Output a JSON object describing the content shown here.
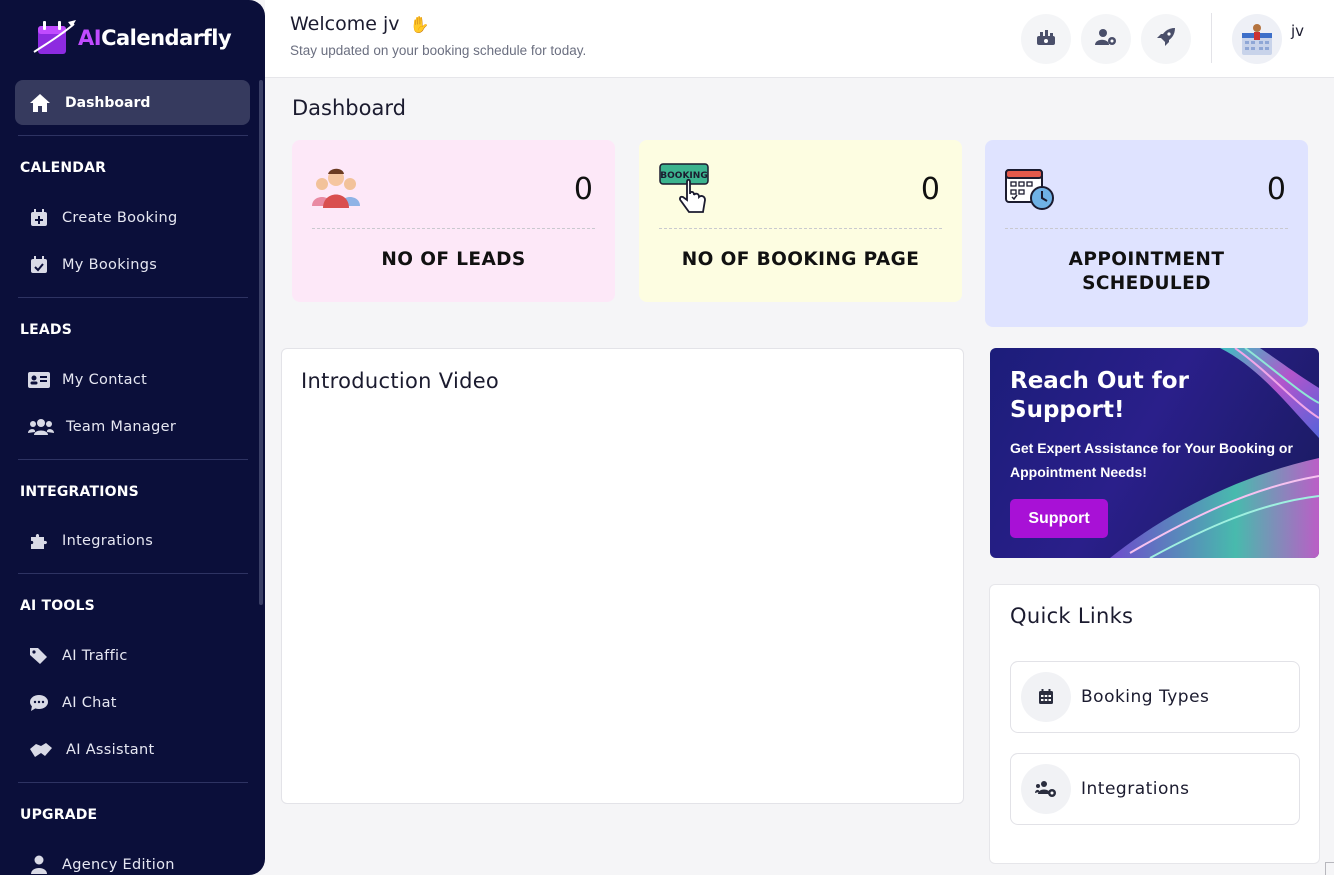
{
  "brand": {
    "logo_prefix": "AI",
    "logo_suffix": "Calendarfly"
  },
  "sidebar": {
    "active": {
      "label": "Dashboard",
      "icon": "home-icon"
    },
    "sections": [
      {
        "title": "CALENDAR",
        "items": [
          {
            "label": "Create Booking",
            "icon": "calendar-plus-icon"
          },
          {
            "label": "My Bookings",
            "icon": "calendar-check-icon"
          }
        ]
      },
      {
        "title": "LEADS",
        "items": [
          {
            "label": "My Contact",
            "icon": "contact-card-icon"
          },
          {
            "label": "Team Manager",
            "icon": "users-icon"
          }
        ]
      },
      {
        "title": "INTEGRATIONS",
        "items": [
          {
            "label": "Integrations",
            "icon": "puzzle-icon"
          }
        ]
      },
      {
        "title": "AI TOOLS",
        "items": [
          {
            "label": "AI Traffic",
            "icon": "tags-icon"
          },
          {
            "label": "AI Chat",
            "icon": "chat-icon"
          },
          {
            "label": "AI Assistant",
            "icon": "handshake-icon"
          }
        ]
      },
      {
        "title": "UPGRADE",
        "items": [
          {
            "label": "Agency Edition",
            "icon": "user-icon"
          }
        ]
      }
    ]
  },
  "header": {
    "welcome": "Welcome jv",
    "subtitle": "Stay updated on your booking schedule for today.",
    "username": "jv",
    "buttons": [
      "dashboard-chart-icon",
      "user-settings-icon",
      "rocket-icon"
    ]
  },
  "main": {
    "title": "Dashboard",
    "stats": [
      {
        "value": "0",
        "label": "NO OF LEADS",
        "bg": "#fde8f8",
        "icon": "people-icon"
      },
      {
        "value": "0",
        "label": "NO OF BOOKING PAGE",
        "bg": "#fdfde1",
        "icon": "booking-click-icon"
      },
      {
        "value": "0",
        "label": "APPOINTMENT SCHEDULED",
        "bg": "#dfe3ff",
        "icon": "calendar-clock-icon"
      }
    ],
    "video": {
      "title": "Introduction Video"
    },
    "support": {
      "title": "Reach Out for Support!",
      "description": "Get Expert Assistance for Your Booking or Appointment Needs!",
      "button": "Support",
      "button_color": "#a811d6"
    },
    "quick_links": {
      "title": "Quick Links",
      "items": [
        {
          "label": "Booking Types",
          "icon": "calendar-grid-icon"
        },
        {
          "label": "Integrations",
          "icon": "users-cog-icon"
        }
      ]
    }
  },
  "colors": {
    "sidebar_bg": "#0b0f3a",
    "active_item_bg": "#363a5e",
    "page_bg": "#f5f5f7",
    "accent": "#a811d6"
  }
}
